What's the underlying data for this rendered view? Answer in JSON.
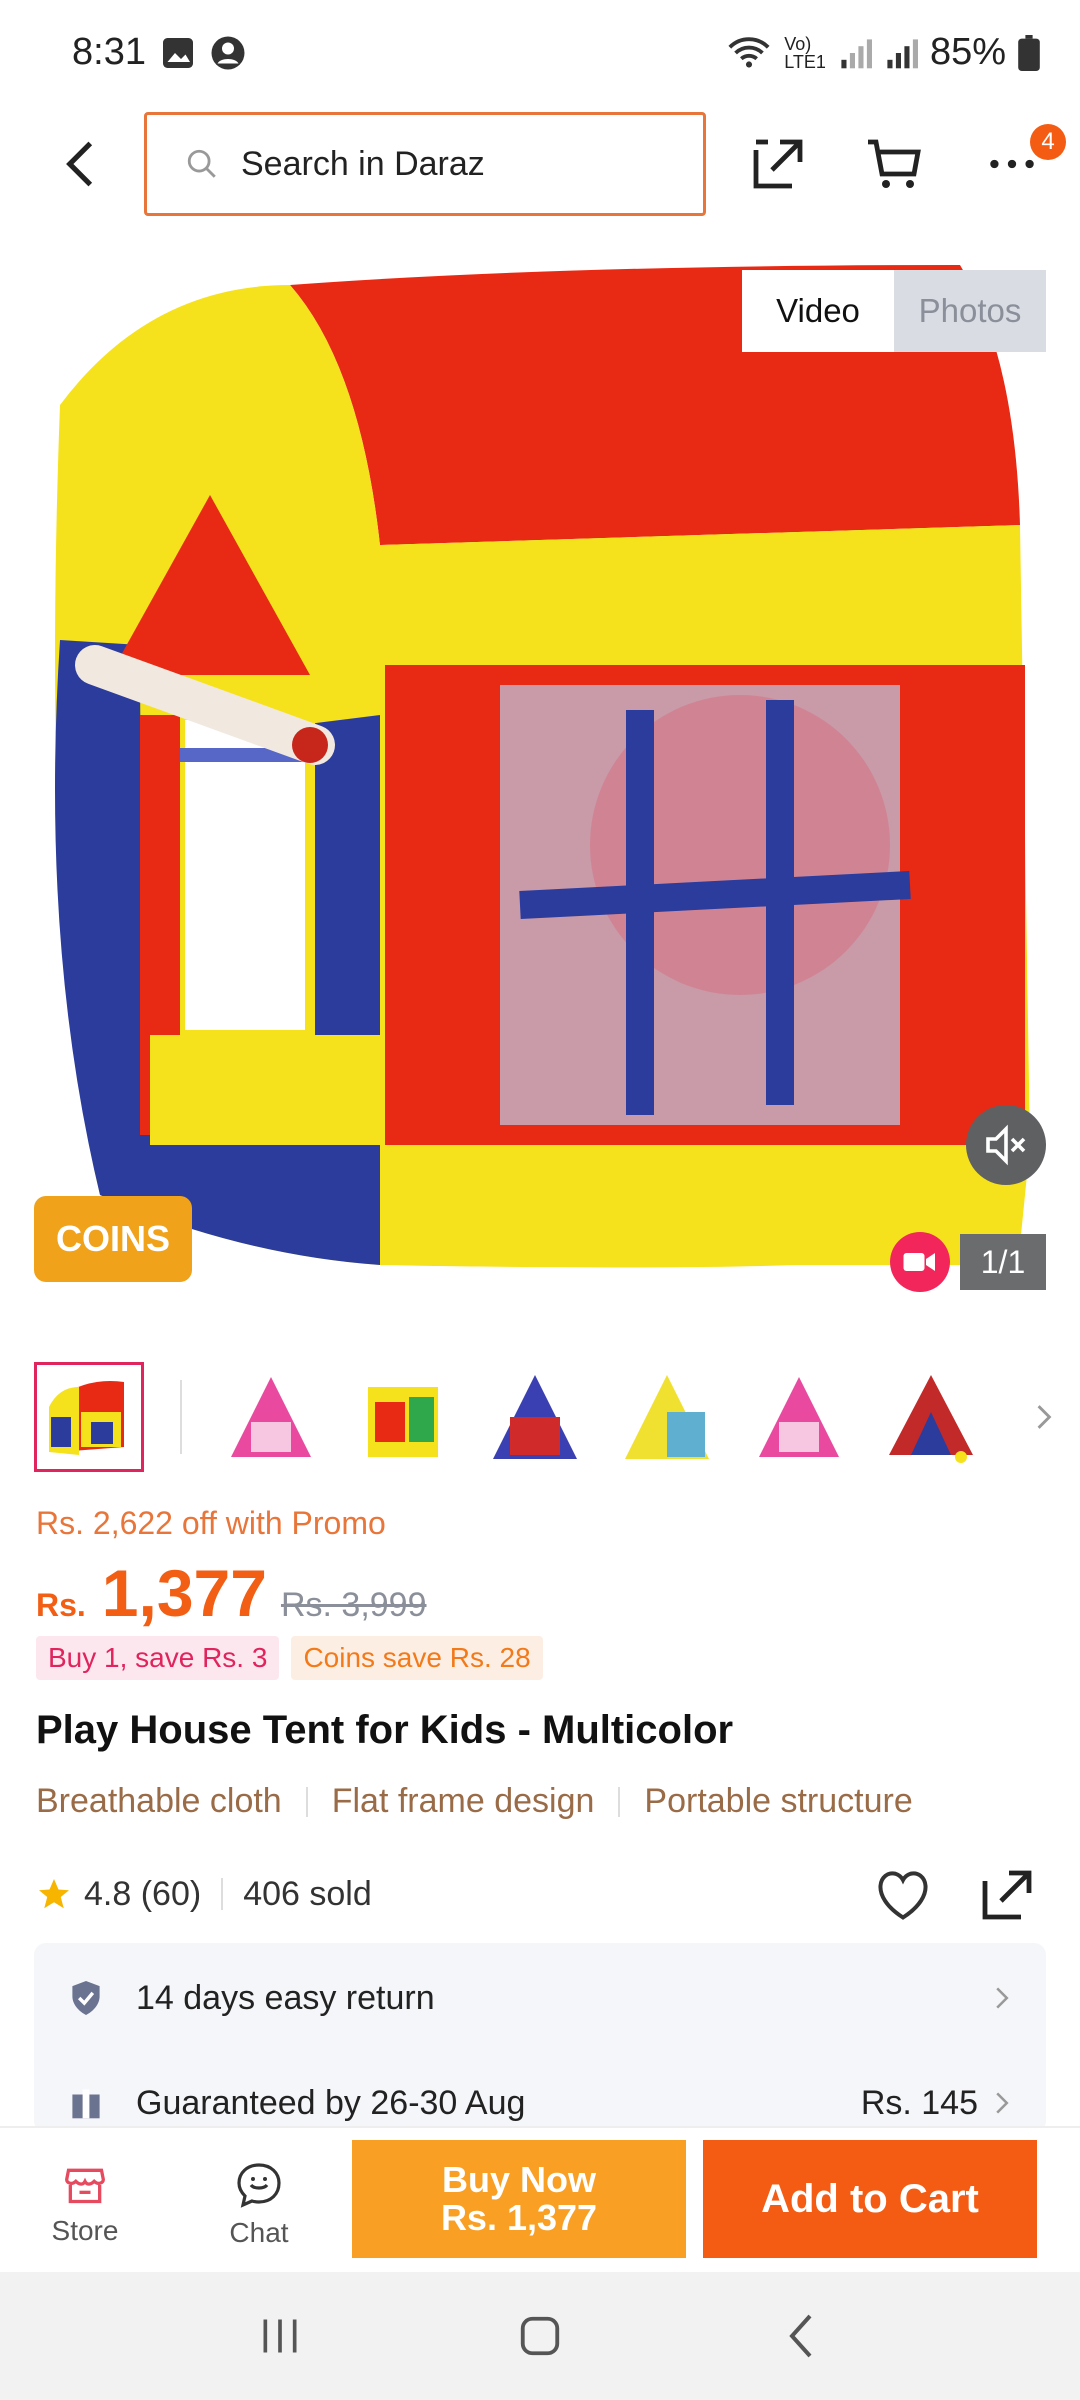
{
  "status_bar": {
    "time": "8:31",
    "battery": "85%"
  },
  "search": {
    "placeholder": "Search in Daraz"
  },
  "cart_badge": "4",
  "media": {
    "tab_video": "Video",
    "tab_photos": "Photos",
    "counter": "1/1",
    "coins_label": "COINS"
  },
  "price": {
    "promo": "Rs. 2,622 off with Promo",
    "currency": "Rs.",
    "current": "1,377",
    "original": "Rs. 3,999",
    "chip_buy": "Buy 1, save Rs. 3",
    "chip_coins": "Coins save Rs. 28"
  },
  "product": {
    "title": "Play House Tent for Kids - Multicolor",
    "features": [
      "Breathable cloth",
      "Flat frame design",
      "Portable structure"
    ],
    "rating": "4.8 (60)",
    "sold": "406 sold"
  },
  "info": {
    "return": "14 days easy return",
    "delivery": "Guaranteed by 26-30 Aug",
    "delivery_price": "Rs. 145"
  },
  "actions": {
    "store": "Store",
    "chat": "Chat",
    "buy_now": "Buy Now",
    "buy_now_price": "Rs. 1,377",
    "add_to_cart": "Add to Cart"
  },
  "colors": {
    "accent": "#f45c14",
    "buy_now": "#f9a024",
    "coins": "#f0a21a"
  }
}
